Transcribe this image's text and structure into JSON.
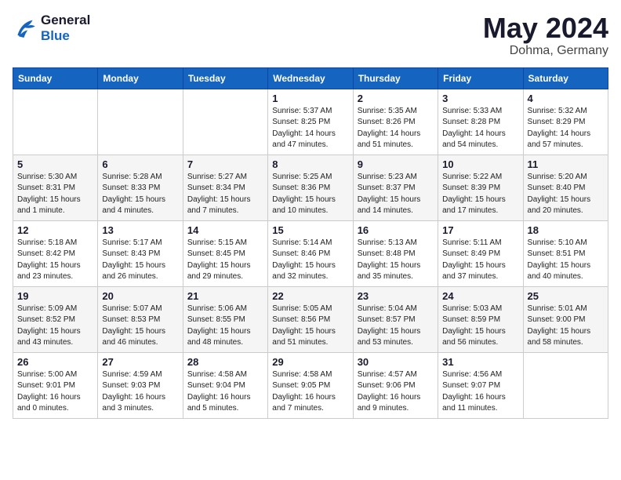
{
  "logo": {
    "line1": "General",
    "line2": "Blue"
  },
  "title": "May 2024",
  "location": "Dohma, Germany",
  "days_header": [
    "Sunday",
    "Monday",
    "Tuesday",
    "Wednesday",
    "Thursday",
    "Friday",
    "Saturday"
  ],
  "weeks": [
    [
      {
        "day": "",
        "info": ""
      },
      {
        "day": "",
        "info": ""
      },
      {
        "day": "",
        "info": ""
      },
      {
        "day": "1",
        "info": "Sunrise: 5:37 AM\nSunset: 8:25 PM\nDaylight: 14 hours\nand 47 minutes."
      },
      {
        "day": "2",
        "info": "Sunrise: 5:35 AM\nSunset: 8:26 PM\nDaylight: 14 hours\nand 51 minutes."
      },
      {
        "day": "3",
        "info": "Sunrise: 5:33 AM\nSunset: 8:28 PM\nDaylight: 14 hours\nand 54 minutes."
      },
      {
        "day": "4",
        "info": "Sunrise: 5:32 AM\nSunset: 8:29 PM\nDaylight: 14 hours\nand 57 minutes."
      }
    ],
    [
      {
        "day": "5",
        "info": "Sunrise: 5:30 AM\nSunset: 8:31 PM\nDaylight: 15 hours\nand 1 minute."
      },
      {
        "day": "6",
        "info": "Sunrise: 5:28 AM\nSunset: 8:33 PM\nDaylight: 15 hours\nand 4 minutes."
      },
      {
        "day": "7",
        "info": "Sunrise: 5:27 AM\nSunset: 8:34 PM\nDaylight: 15 hours\nand 7 minutes."
      },
      {
        "day": "8",
        "info": "Sunrise: 5:25 AM\nSunset: 8:36 PM\nDaylight: 15 hours\nand 10 minutes."
      },
      {
        "day": "9",
        "info": "Sunrise: 5:23 AM\nSunset: 8:37 PM\nDaylight: 15 hours\nand 14 minutes."
      },
      {
        "day": "10",
        "info": "Sunrise: 5:22 AM\nSunset: 8:39 PM\nDaylight: 15 hours\nand 17 minutes."
      },
      {
        "day": "11",
        "info": "Sunrise: 5:20 AM\nSunset: 8:40 PM\nDaylight: 15 hours\nand 20 minutes."
      }
    ],
    [
      {
        "day": "12",
        "info": "Sunrise: 5:18 AM\nSunset: 8:42 PM\nDaylight: 15 hours\nand 23 minutes."
      },
      {
        "day": "13",
        "info": "Sunrise: 5:17 AM\nSunset: 8:43 PM\nDaylight: 15 hours\nand 26 minutes."
      },
      {
        "day": "14",
        "info": "Sunrise: 5:15 AM\nSunset: 8:45 PM\nDaylight: 15 hours\nand 29 minutes."
      },
      {
        "day": "15",
        "info": "Sunrise: 5:14 AM\nSunset: 8:46 PM\nDaylight: 15 hours\nand 32 minutes."
      },
      {
        "day": "16",
        "info": "Sunrise: 5:13 AM\nSunset: 8:48 PM\nDaylight: 15 hours\nand 35 minutes."
      },
      {
        "day": "17",
        "info": "Sunrise: 5:11 AM\nSunset: 8:49 PM\nDaylight: 15 hours\nand 37 minutes."
      },
      {
        "day": "18",
        "info": "Sunrise: 5:10 AM\nSunset: 8:51 PM\nDaylight: 15 hours\nand 40 minutes."
      }
    ],
    [
      {
        "day": "19",
        "info": "Sunrise: 5:09 AM\nSunset: 8:52 PM\nDaylight: 15 hours\nand 43 minutes."
      },
      {
        "day": "20",
        "info": "Sunrise: 5:07 AM\nSunset: 8:53 PM\nDaylight: 15 hours\nand 46 minutes."
      },
      {
        "day": "21",
        "info": "Sunrise: 5:06 AM\nSunset: 8:55 PM\nDaylight: 15 hours\nand 48 minutes."
      },
      {
        "day": "22",
        "info": "Sunrise: 5:05 AM\nSunset: 8:56 PM\nDaylight: 15 hours\nand 51 minutes."
      },
      {
        "day": "23",
        "info": "Sunrise: 5:04 AM\nSunset: 8:57 PM\nDaylight: 15 hours\nand 53 minutes."
      },
      {
        "day": "24",
        "info": "Sunrise: 5:03 AM\nSunset: 8:59 PM\nDaylight: 15 hours\nand 56 minutes."
      },
      {
        "day": "25",
        "info": "Sunrise: 5:01 AM\nSunset: 9:00 PM\nDaylight: 15 hours\nand 58 minutes."
      }
    ],
    [
      {
        "day": "26",
        "info": "Sunrise: 5:00 AM\nSunset: 9:01 PM\nDaylight: 16 hours\nand 0 minutes."
      },
      {
        "day": "27",
        "info": "Sunrise: 4:59 AM\nSunset: 9:03 PM\nDaylight: 16 hours\nand 3 minutes."
      },
      {
        "day": "28",
        "info": "Sunrise: 4:58 AM\nSunset: 9:04 PM\nDaylight: 16 hours\nand 5 minutes."
      },
      {
        "day": "29",
        "info": "Sunrise: 4:58 AM\nSunset: 9:05 PM\nDaylight: 16 hours\nand 7 minutes."
      },
      {
        "day": "30",
        "info": "Sunrise: 4:57 AM\nSunset: 9:06 PM\nDaylight: 16 hours\nand 9 minutes."
      },
      {
        "day": "31",
        "info": "Sunrise: 4:56 AM\nSunset: 9:07 PM\nDaylight: 16 hours\nand 11 minutes."
      },
      {
        "day": "",
        "info": ""
      }
    ]
  ]
}
